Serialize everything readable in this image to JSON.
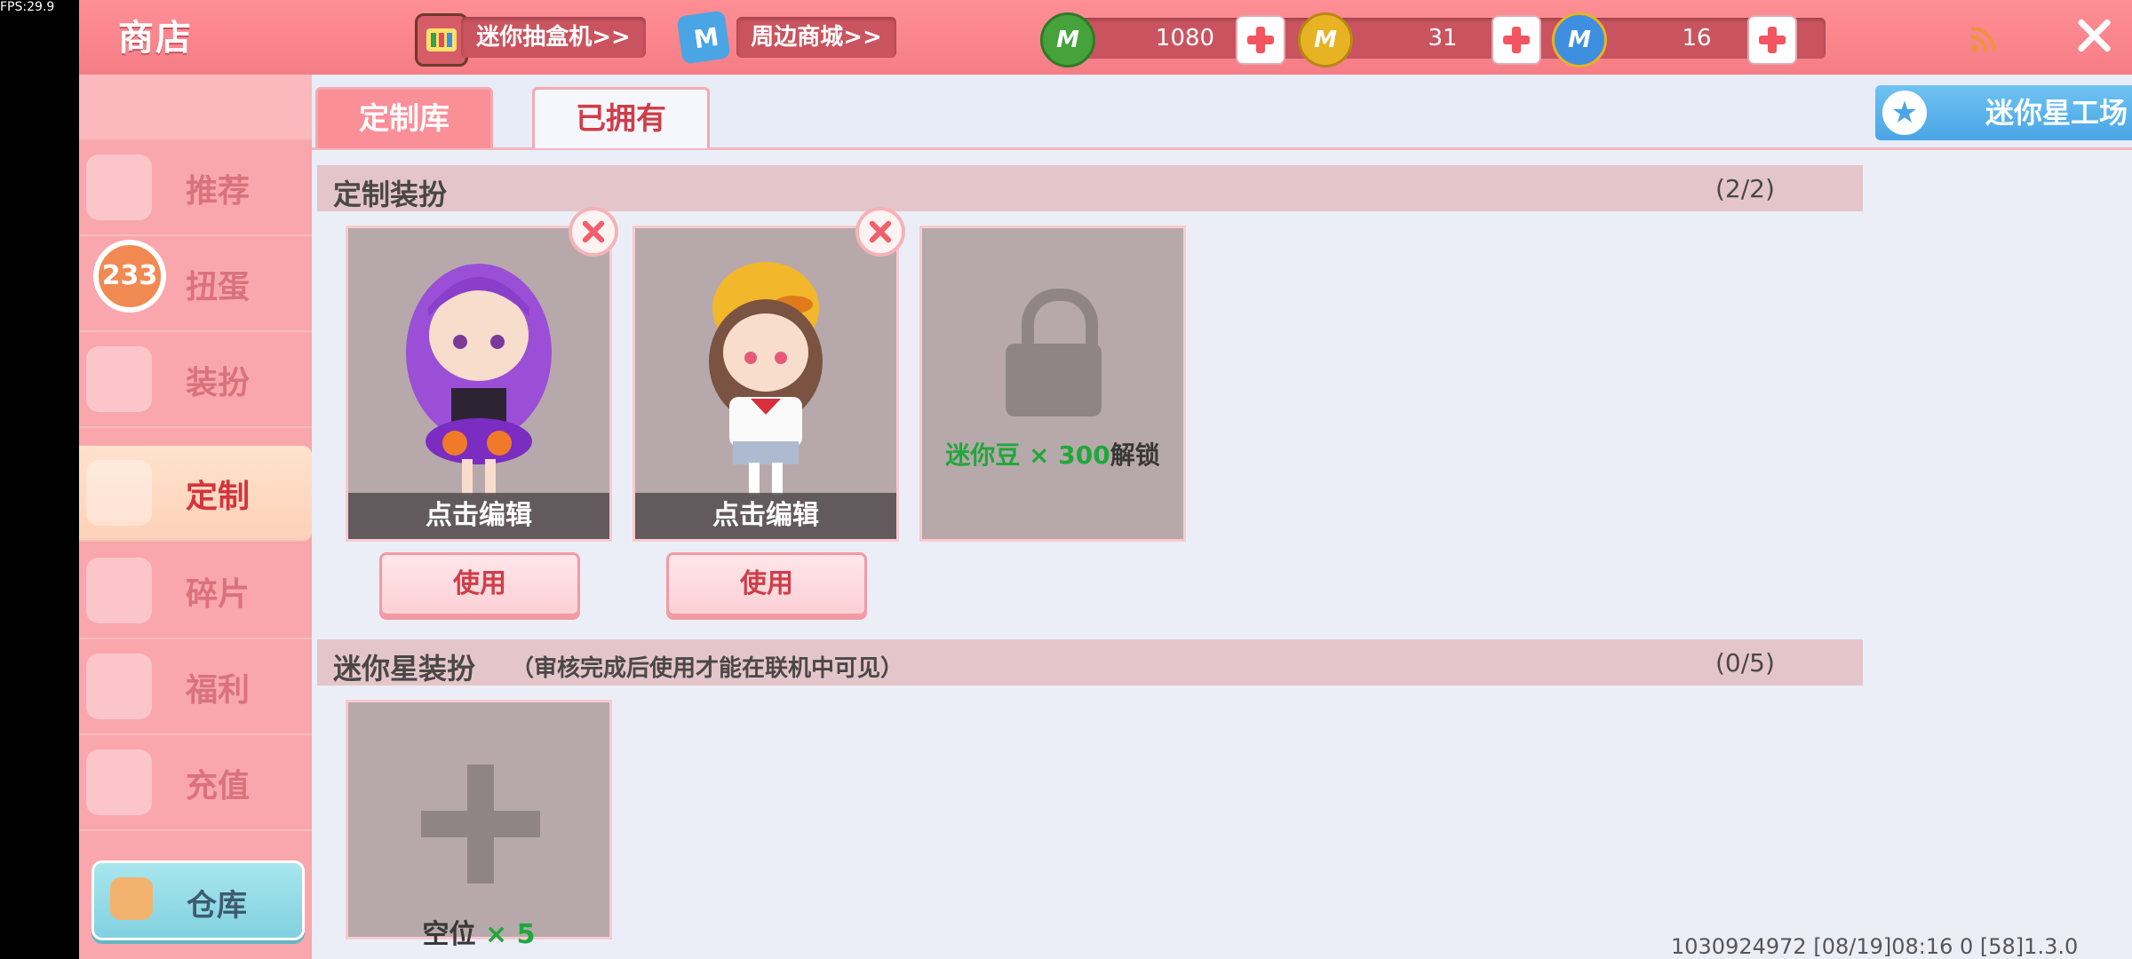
{
  "fps": "FPS:29.9",
  "header": {
    "title": "商店",
    "links": [
      {
        "label": "迷你抽盒机>>",
        "icon": "gacha-machine-icon"
      },
      {
        "label": "周边商城>>",
        "icon": "shopping-bag-icon"
      }
    ],
    "currencies": [
      {
        "value": "1080",
        "icon": "green-bean-icon",
        "color": "#46a23a"
      },
      {
        "value": "31",
        "icon": "gold-coin-icon",
        "color": "#e7b324"
      },
      {
        "value": "16",
        "icon": "blue-coin-icon",
        "color": "#3f8fe0"
      }
    ]
  },
  "sidebar": {
    "items": [
      {
        "label": "推荐",
        "icon": "thumbs-up-icon"
      },
      {
        "label": "扭蛋",
        "icon": "capsule-icon"
      },
      {
        "label": "装扮",
        "icon": "tshirt-icon"
      },
      {
        "label": "定制",
        "icon": "pencil-icon"
      },
      {
        "label": "碎片",
        "icon": "shard-icon"
      },
      {
        "label": "福利",
        "icon": "gift-icon"
      },
      {
        "label": "充值",
        "icon": "coins-icon"
      }
    ],
    "badge": "233",
    "warehouse": "仓库"
  },
  "tabs": {
    "custom": "定制库",
    "owned": "已拥有",
    "workshop": "迷你星工场"
  },
  "sections": {
    "custom": {
      "title": "定制装扮",
      "count": "(2/2)"
    },
    "star": {
      "title": "迷你星装扮",
      "subtitle": "（审核完成后使用才能在联机中可见）",
      "count": "(0/5)"
    }
  },
  "cards": {
    "edit_label": "点击编辑",
    "use_label": "使用",
    "unlock": {
      "highlight": "迷你豆 × 300",
      "suffix": "解锁"
    },
    "slot": {
      "label": "空位",
      "count": "× 5"
    }
  },
  "footer": "1030924972  [08/19]08:16 0  [58]1.3.0"
}
